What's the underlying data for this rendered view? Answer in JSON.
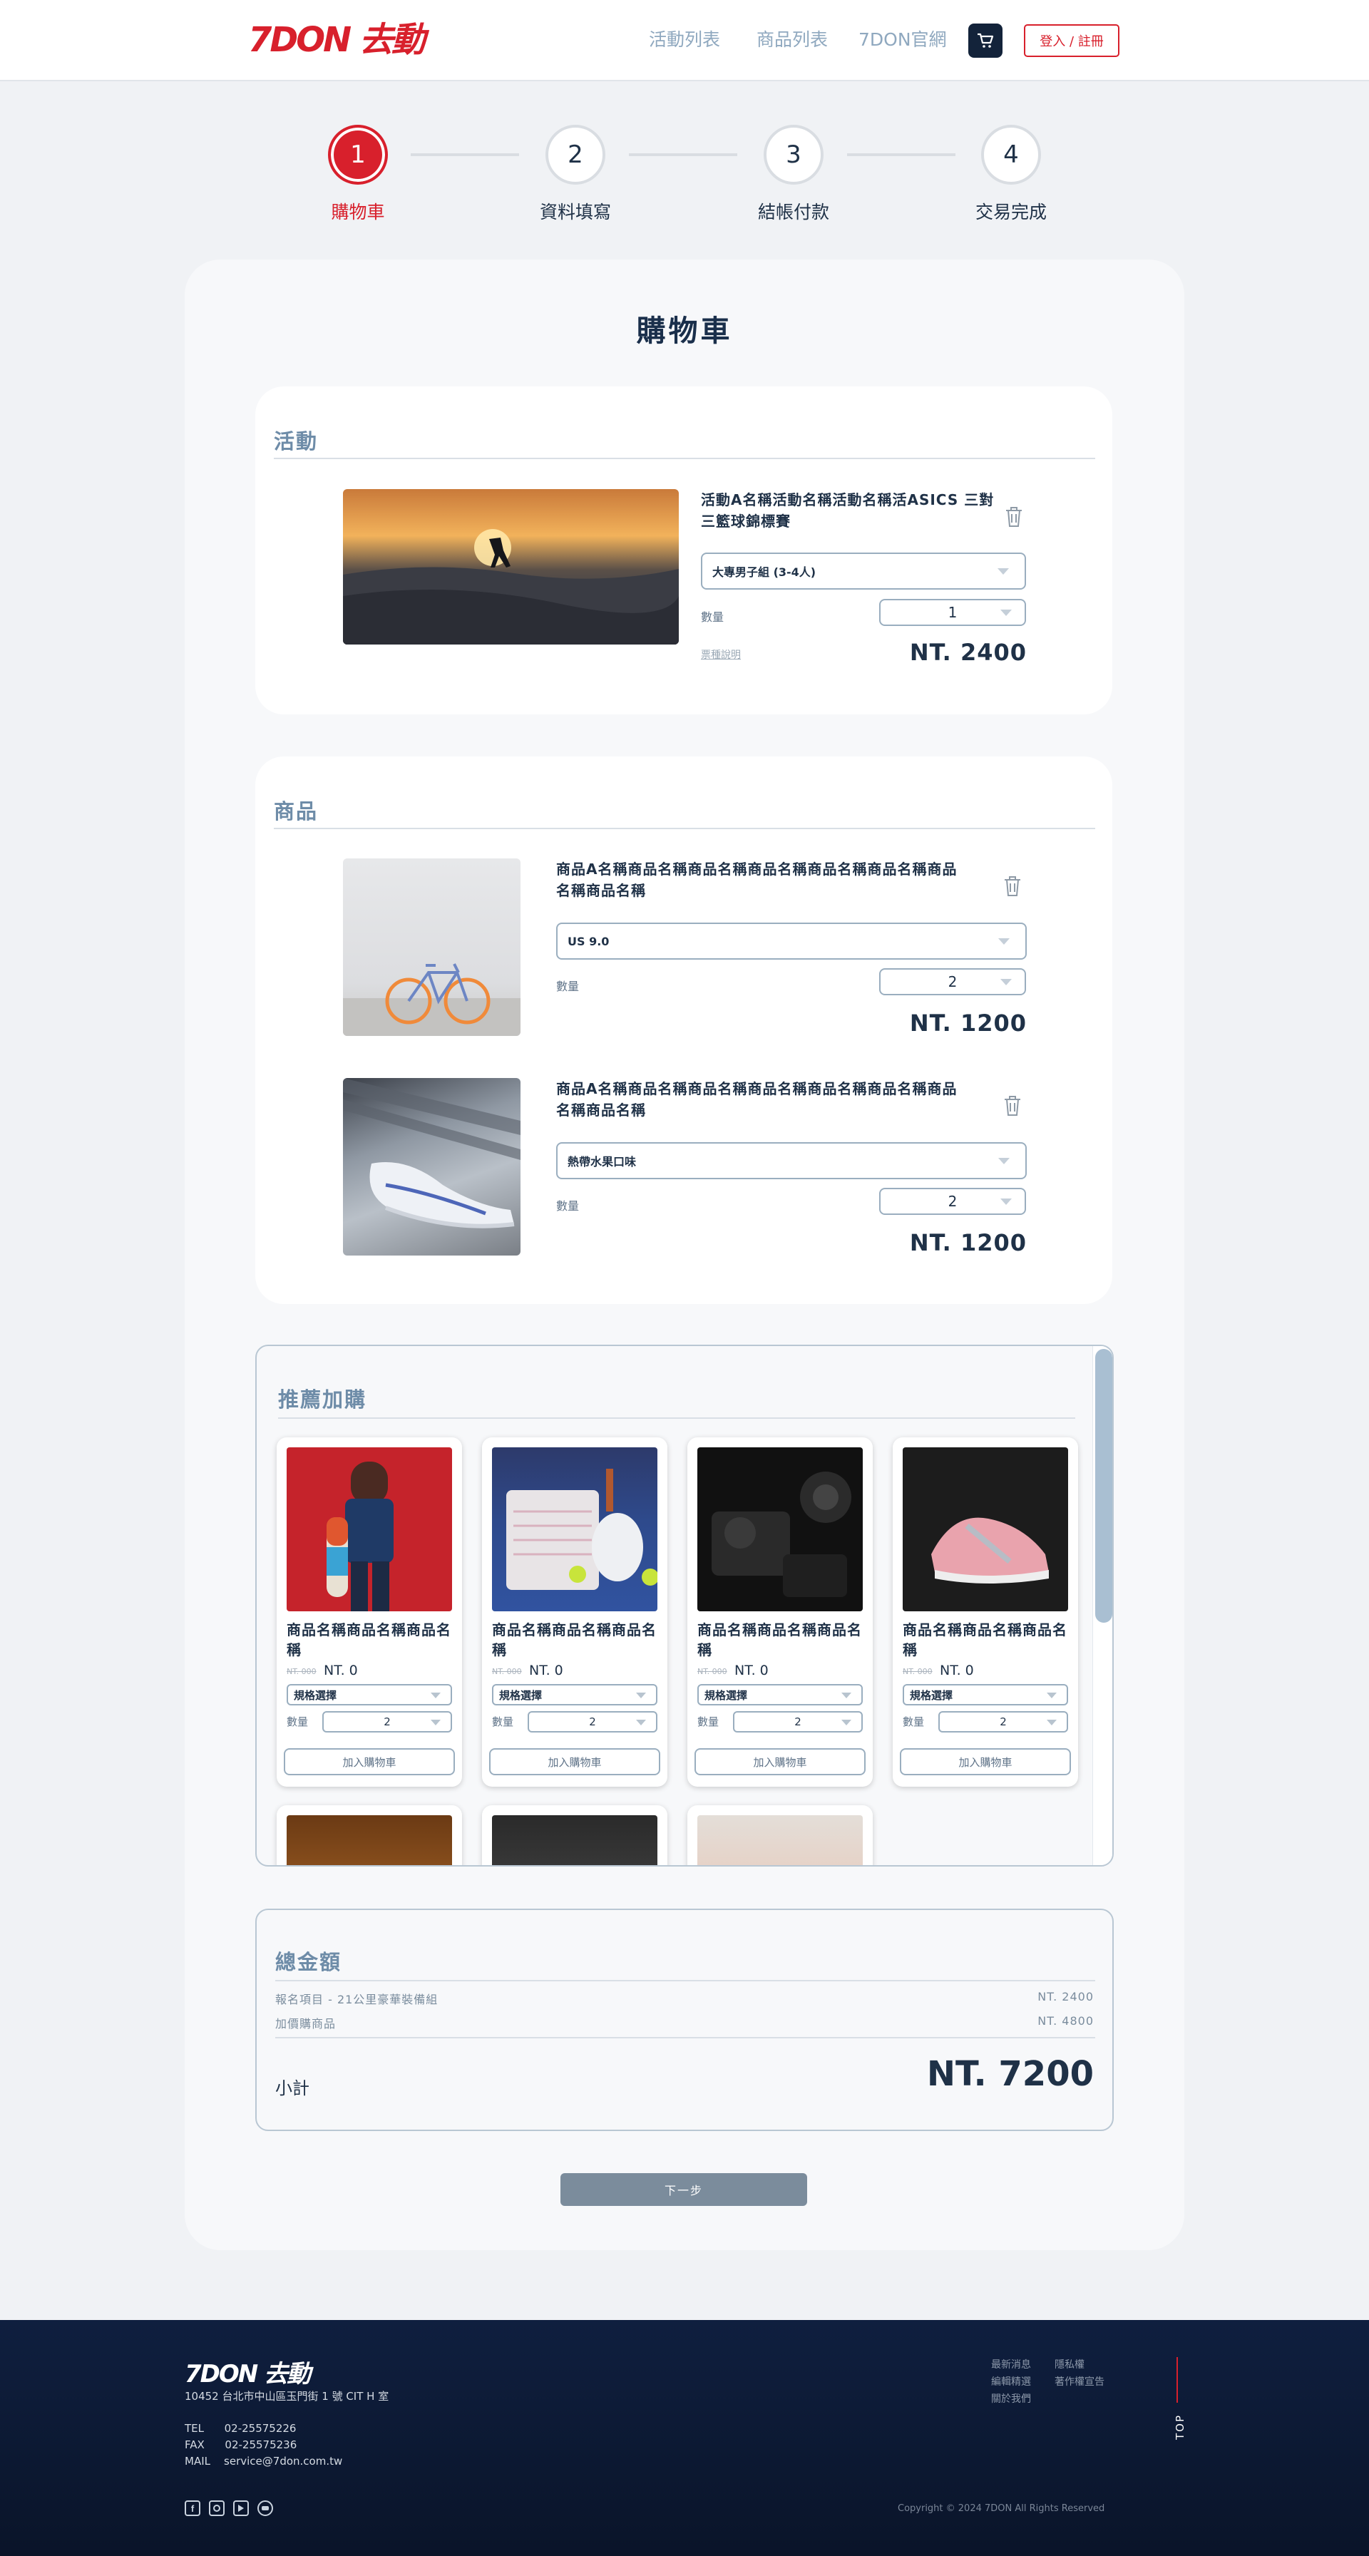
{
  "header": {
    "logo": "7DON 去動",
    "nav": [
      "活動列表",
      "商品列表",
      "7DON官網"
    ],
    "login": "登入 / 註冊"
  },
  "steps": [
    {
      "num": "1",
      "label": "購物車"
    },
    {
      "num": "2",
      "label": "資料填寫"
    },
    {
      "num": "3",
      "label": "結帳付款"
    },
    {
      "num": "4",
      "label": "交易完成"
    }
  ],
  "page_title": "購物車",
  "activity": {
    "section_title": "活動",
    "title": "活動A名稱活動名稱活動名稱活ASICS 三對三籃球錦標賽",
    "option": "大專男子組 (3-4人)",
    "qty_label": "數量",
    "qty": "1",
    "note_link": "票種說明",
    "price": "NT. 2400"
  },
  "products": {
    "section_title": "商品",
    "items": [
      {
        "title": "商品A名稱商品名稱商品名稱商品名稱商品名稱商品名稱商品名稱商品名稱",
        "option": "US 9.0",
        "qty_label": "數量",
        "qty": "2",
        "price": "NT. 1200"
      },
      {
        "title": "商品A名稱商品名稱商品名稱商品名稱商品名稱商品名稱商品名稱商品名稱",
        "option": "熱帶水果口味",
        "qty_label": "數量",
        "qty": "2",
        "price": "NT. 1200"
      }
    ]
  },
  "recommend": {
    "section_title": "推薦加購",
    "items": [
      {
        "name": "商品名稱商品名稱商品名稱",
        "old_price": "NT. 000",
        "price": "NT. 0",
        "spec": "規格選擇",
        "qty_label": "數量",
        "qty": "2",
        "add": "加入購物車"
      },
      {
        "name": "商品名稱商品名稱商品名稱",
        "old_price": "NT. 000",
        "price": "NT. 0",
        "spec": "規格選擇",
        "qty_label": "數量",
        "qty": "2",
        "add": "加入購物車"
      },
      {
        "name": "商品名稱商品名稱商品名稱",
        "old_price": "NT. 000",
        "price": "NT. 0",
        "spec": "規格選擇",
        "qty_label": "數量",
        "qty": "2",
        "add": "加入購物車"
      },
      {
        "name": "商品名稱商品名稱商品名稱",
        "old_price": "NT. 000",
        "price": "NT. 0",
        "spec": "規格選擇",
        "qty_label": "數量",
        "qty": "2",
        "add": "加入購物車"
      }
    ]
  },
  "total": {
    "section_title": "總金額",
    "rows": [
      {
        "label": "報名項目 - 21公里豪華裝備組",
        "value": "NT. 2400"
      },
      {
        "label": "加價購商品",
        "value": "NT. 4800"
      }
    ],
    "subtotal_label": "小計",
    "subtotal": "NT. 7200"
  },
  "next_button": "下一步",
  "footer": {
    "logo": "7DON 去動",
    "address": "10452 台北市中山區玉門街 1 號 CIT H 室",
    "tel": "TEL      02-25575226",
    "fax": "FAX      02-25575236",
    "mail": "MAIL    service@7don.com.tw",
    "links_col1": [
      "最新消息",
      "編輯精選",
      "關於我們"
    ],
    "links_col2": [
      "隱私權",
      "著作權宣告"
    ],
    "top": "TOP",
    "copyright": "Copyright © 2024 7DON All Rights Reserved"
  },
  "colors": {
    "brand_red": "#d8202c",
    "navy": "#13233a",
    "steel": "#6e8ca8"
  },
  "icons": [
    "cart-icon",
    "trash-icon",
    "facebook-icon",
    "instagram-icon",
    "youtube-icon",
    "line-icon"
  ]
}
